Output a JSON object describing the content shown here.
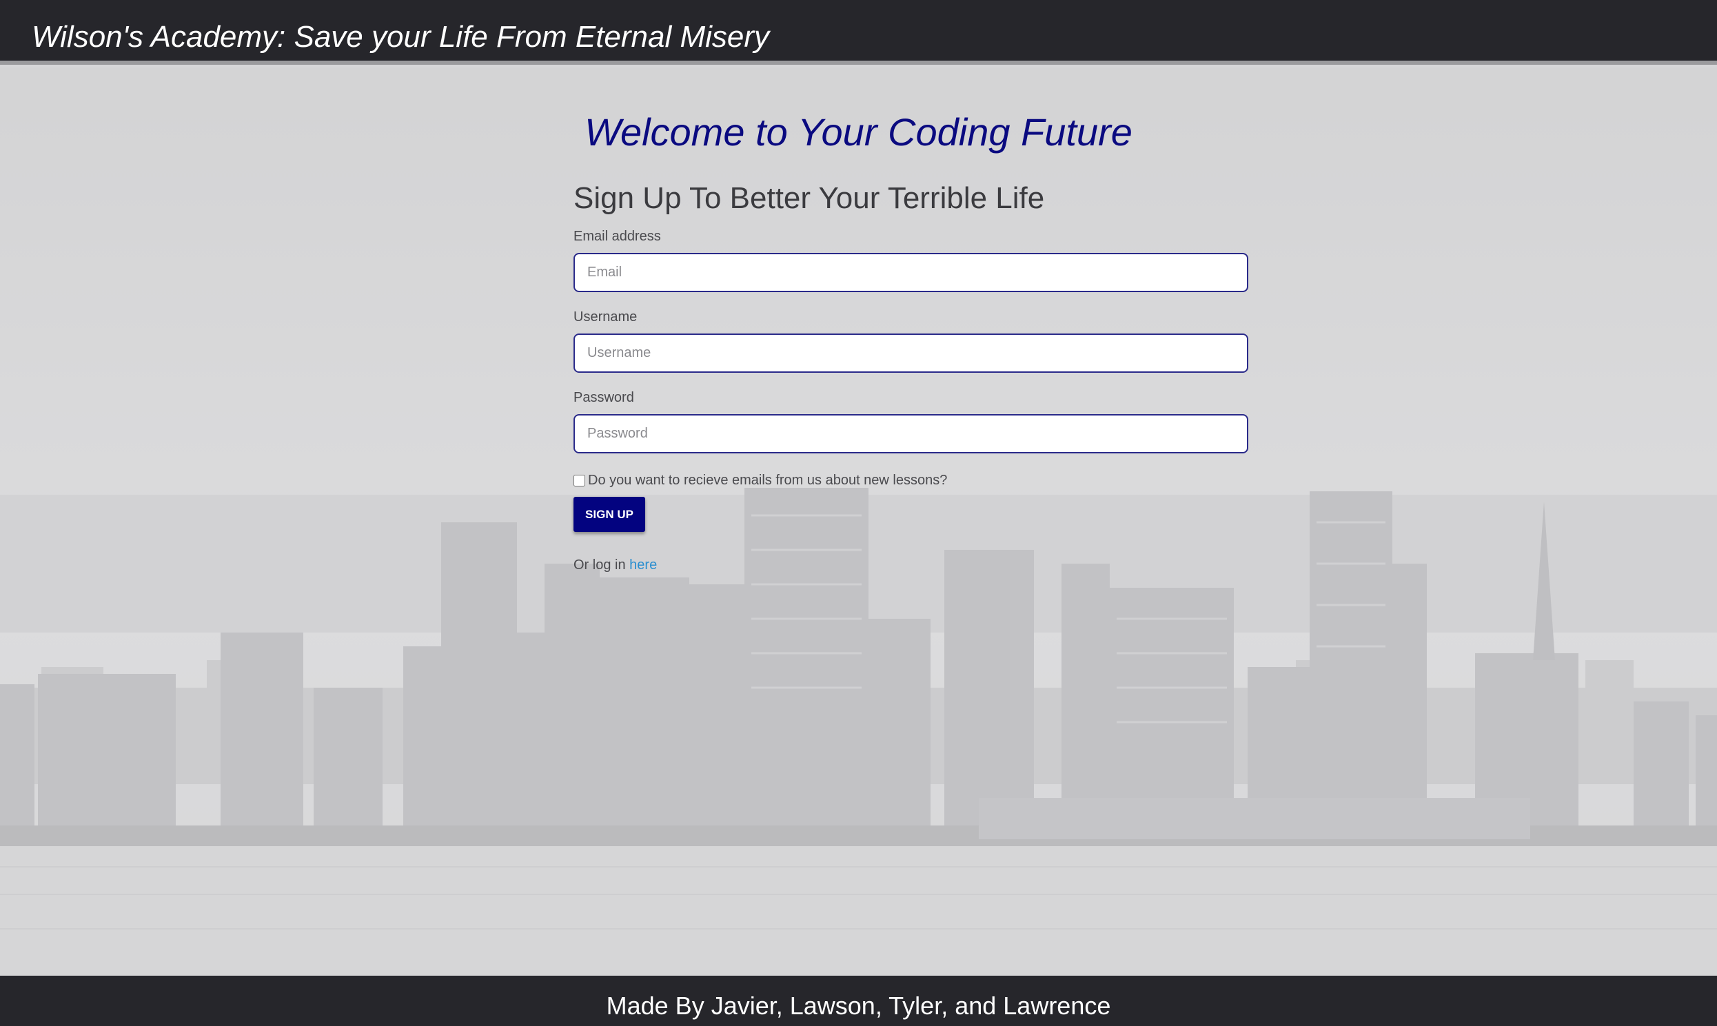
{
  "header": {
    "brand": "Wilson's Academy: Save your Life From Eternal Misery"
  },
  "main": {
    "welcome": "Welcome to Your Coding Future",
    "form_title": "Sign Up To Better Your Terrible Life",
    "fields": [
      {
        "label": "Email address",
        "placeholder": "Email",
        "value": ""
      },
      {
        "label": "Username",
        "placeholder": "Username",
        "value": ""
      },
      {
        "label": "Password",
        "placeholder": "Password",
        "value": ""
      }
    ],
    "newsletter_checkbox": {
      "label": "Do you want to recieve emails from us about new lessons?",
      "checked": false
    },
    "signup_button": "SIGN UP",
    "login": {
      "prefix": "Or log in",
      "link_text": "here"
    }
  },
  "footer": {
    "text": "Made By Javier, Lawson, Tyler, and Lawrence"
  },
  "colors": {
    "navbar": "#26262b",
    "accent": "#030380",
    "heading": "#0a0a80",
    "link": "#2b8fd0"
  },
  "background_image": "city-skyline-grayscale"
}
